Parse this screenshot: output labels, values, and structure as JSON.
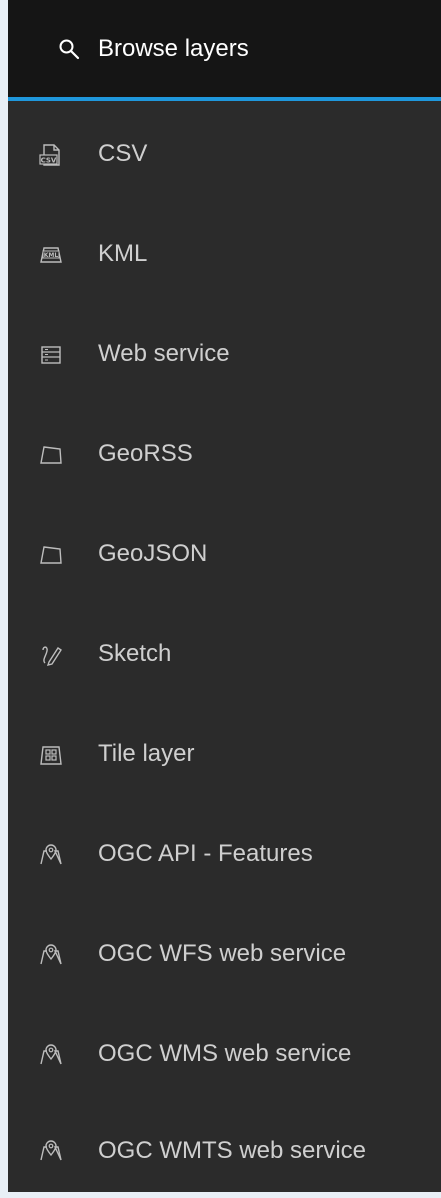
{
  "header": {
    "label": "Browse layers",
    "icon": "search-icon"
  },
  "menu": {
    "items": [
      {
        "label": "CSV",
        "icon": "csv-file-icon"
      },
      {
        "label": "KML",
        "icon": "kml-map-icon"
      },
      {
        "label": "Web service",
        "icon": "web-service-icon"
      },
      {
        "label": "GeoRSS",
        "icon": "map-outline-icon"
      },
      {
        "label": "GeoJSON",
        "icon": "map-outline-icon"
      },
      {
        "label": "Sketch",
        "icon": "sketch-pencil-icon"
      },
      {
        "label": "Tile layer",
        "icon": "tile-layer-icon"
      },
      {
        "label": "OGC API - Features",
        "icon": "map-pin-icon"
      },
      {
        "label": "OGC WFS web service",
        "icon": "map-pin-icon"
      },
      {
        "label": "OGC WMS web service",
        "icon": "map-pin-icon"
      },
      {
        "label": "OGC WMTS web service",
        "icon": "map-pin-icon"
      }
    ]
  },
  "colors": {
    "panel_bg": "#2b2b2b",
    "header_bg": "#151515",
    "accent": "#1f97dc",
    "text": "#cfcfcf"
  }
}
